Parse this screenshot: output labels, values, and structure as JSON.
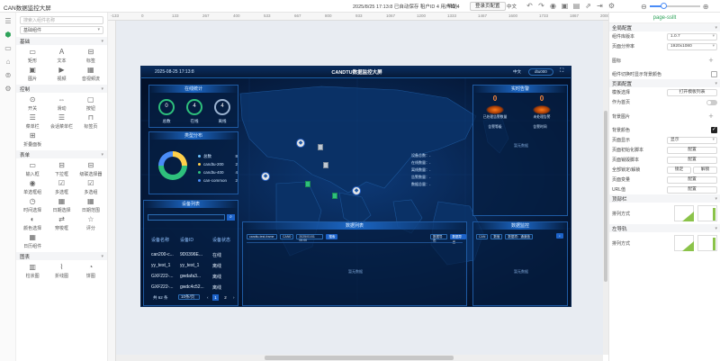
{
  "app": {
    "title": "CAN数据监控大屏",
    "info": "2025/8/25 17:13:8 已自动保存  租户ID 4 用户ID 4",
    "help": "帮助",
    "login_btn": "登录页配置",
    "lang": "中文"
  },
  "toolbar_icons": [
    "undo-icon",
    "redo-icon",
    "eye-icon",
    "save-icon",
    "save-as-icon",
    "share-icon",
    "export-icon",
    "settings-icon"
  ],
  "zoom": {
    "value_fraction": 0.28
  },
  "rail": [
    "layers-icon",
    "component-icon",
    "page-icon",
    "folder-icon",
    "data-icon",
    "gear-icon"
  ],
  "components": {
    "search_placeholder": "搜索入组件名称",
    "filter": "基础组件",
    "groups": [
      {
        "name": "基础",
        "items": [
          {
            "label": "矩形",
            "icon": "▭"
          },
          {
            "label": "文本",
            "icon": "A"
          },
          {
            "label": "标签",
            "icon": "⊟"
          },
          {
            "label": "图片",
            "icon": "▣"
          },
          {
            "label": "视频",
            "icon": "▶"
          },
          {
            "label": "音视频流",
            "icon": "▦"
          }
        ]
      },
      {
        "name": "控制",
        "items": [
          {
            "label": "开关",
            "icon": "⊙"
          },
          {
            "label": "滑动",
            "icon": "⇔"
          },
          {
            "label": "按钮",
            "icon": "▢"
          },
          {
            "label": "菜单栏",
            "icon": "☰"
          },
          {
            "label": "会话菜单栏",
            "icon": "☰"
          },
          {
            "label": "标签页",
            "icon": "⊓"
          },
          {
            "label": "折叠面板",
            "icon": "⊞"
          }
        ]
      },
      {
        "name": "表单",
        "items": [
          {
            "label": "输入框",
            "icon": "▭"
          },
          {
            "label": "下拉框",
            "icon": "⊟"
          },
          {
            "label": "级联选择器",
            "icon": "⊟"
          },
          {
            "label": "单选框组",
            "icon": "◉"
          },
          {
            "label": "多选框",
            "icon": "☑"
          },
          {
            "label": "多选组",
            "icon": "☑"
          },
          {
            "label": "时间选择",
            "icon": "◷"
          },
          {
            "label": "日期选择",
            "icon": "▦"
          },
          {
            "label": "日期范围",
            "icon": "▦"
          },
          {
            "label": "颜色选择",
            "icon": "◐"
          },
          {
            "label": "穿梭框",
            "icon": "⇄"
          },
          {
            "label": "评分",
            "icon": "☆"
          },
          {
            "label": "日历组件",
            "icon": "▦"
          }
        ]
      },
      {
        "name": "图表",
        "items": [
          {
            "label": "柱状图",
            "icon": "▥"
          },
          {
            "label": "折线图",
            "icon": "⌇"
          },
          {
            "label": "饼图",
            "icon": "◔"
          }
        ]
      }
    ]
  },
  "ruler_ticks": [
    "-133",
    "0",
    "133",
    "267",
    "400",
    "533",
    "667",
    "800",
    "933",
    "1067",
    "1200",
    "1333",
    "1467",
    "1600",
    "1733",
    "1867",
    "2000"
  ],
  "dashboard": {
    "date": "2025-08-25 17:13:8",
    "title": "CANDTU数据监控大屏",
    "lang": "中文",
    "user": "dtu000",
    "online": {
      "title": "在线统计",
      "rings": [
        {
          "value": "0",
          "label": "总数",
          "color": "#2ec07c"
        },
        {
          "value": "4",
          "label": "在线",
          "color": "#2ec07c"
        },
        {
          "value": "4",
          "label": "离线",
          "color": "#9bb3d1"
        }
      ]
    },
    "types": {
      "title": "类型分布",
      "legend": [
        {
          "name": "总数",
          "value": "8",
          "color": "#6cc3ff"
        },
        {
          "name": "candtu-200",
          "value": "2",
          "color": "#ffd04a"
        },
        {
          "name": "candtu-400",
          "value": "4",
          "color": "#2ec07c"
        },
        {
          "name": "can-common",
          "value": "2",
          "color": "#4a8cf7"
        }
      ],
      "chart_data": {
        "type": "pie",
        "categories": [
          "candtu-200",
          "candtu-400",
          "can-common"
        ],
        "values": [
          2,
          4,
          2
        ]
      }
    },
    "device_list": {
      "title": "设备列表",
      "headers": [
        "设备名称",
        "设备ID",
        "设备状态"
      ],
      "rows": [
        [
          "can200-c...",
          "9D0396E...",
          "在线"
        ],
        [
          "yy_test_1",
          "yy_test_1",
          "离线"
        ],
        [
          "GXF222-...",
          "gwdafa3...",
          "离线"
        ],
        [
          "GXF222-...",
          "gwdc4c52...",
          "离线"
        ]
      ],
      "total": "共 62 条",
      "page_size": "10条/页",
      "pages": [
        "1",
        "2"
      ]
    },
    "info_box": [
      "设备总数：-",
      "在线数量：-",
      "离线数量：-",
      "告警数量：-",
      "数据总量：-"
    ],
    "alarm": {
      "title": "实时告警",
      "items": [
        {
          "value": "0",
          "label": "已处理告警数量"
        },
        {
          "value": "0",
          "label": "未处理告警"
        }
      ],
      "sub": [
        "告警等级",
        "告警时间"
      ],
      "empty": "暂无数据"
    },
    "data_list": {
      "title": "数据列表",
      "controls": [
        "candtu-test-frame",
        "CAN0",
        "2025/01/01 00:00",
        "搜索"
      ],
      "buttons": [
        "数据导出",
        "数据导出"
      ],
      "empty": "暂无数据"
    },
    "data_monitor": {
      "title": "数据监控",
      "controls": [
        "CAN",
        "数值",
        "数据项：通道值"
      ],
      "empty": "暂无数据"
    }
  },
  "props": {
    "top_label": "page-ssllt",
    "sections": [
      {
        "name": "全局配置",
        "rows": [
          {
            "label": "组件库版本",
            "ctl": "select",
            "value": "1.0.7"
          },
          {
            "label": "页面分辨率",
            "ctl": "select",
            "value": "1920x1080"
          },
          {
            "label": "图标",
            "ctl": "plus"
          },
          {
            "label": "组件切换时显示背景颜色",
            "ctl": "checkbox",
            "checked": false
          }
        ]
      },
      {
        "name": "页面配置",
        "rows": [
          {
            "label": "模板选择",
            "ctl": "button",
            "value": "打开模板列表"
          },
          {
            "label": "作为首页",
            "ctl": "toggle"
          },
          {
            "label": "背景图片",
            "ctl": "plus"
          },
          {
            "label": "背景颜色",
            "ctl": "checkbox",
            "checked": true
          },
          {
            "label": "页面显示",
            "ctl": "select",
            "value": "显示"
          },
          {
            "label": "页面初始化脚本",
            "ctl": "button",
            "value": "配置"
          },
          {
            "label": "页面销毁脚本",
            "ctl": "button",
            "value": "配置"
          },
          {
            "label": "全部锁定/解锁",
            "ctl": "double",
            "value": "锁定",
            "value2": "解锁"
          },
          {
            "label": "页面变量",
            "ctl": "button",
            "value": "配置"
          },
          {
            "label": "URL值",
            "ctl": "button",
            "value": "配置"
          }
        ]
      },
      {
        "name": "顶部栏",
        "rows": [
          {
            "label": "排列方式",
            "ctl": "layout"
          }
        ]
      },
      {
        "name": "左导轨",
        "rows": [
          {
            "label": "排列方式",
            "ctl": "layout"
          }
        ]
      }
    ]
  }
}
